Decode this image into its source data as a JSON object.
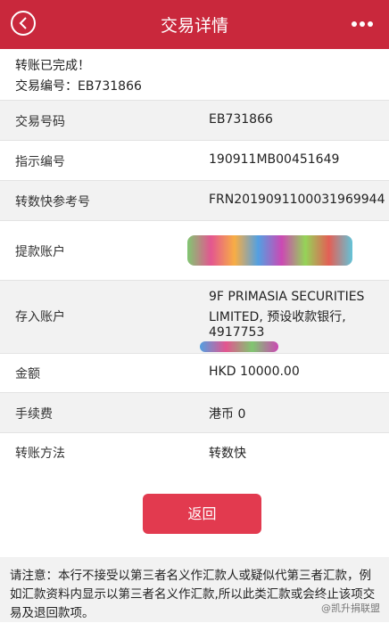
{
  "header": {
    "title": "交易详情"
  },
  "status": {
    "line1": "转账已完成！",
    "line2": "交易编号：EB731866"
  },
  "rows": [
    {
      "label": "交易号码",
      "value": "EB731866"
    },
    {
      "label": "指示编号",
      "value": "190911MB00451649"
    },
    {
      "label": "转数快参考号",
      "value": "FRN2019091100031969944"
    },
    {
      "label": "提款账户",
      "value": ""
    },
    {
      "label": "存入账户",
      "value_lines": [
        "9F PRIMASIA SECURITIES",
        "LIMITED, 预设收款银行,",
        "4917753"
      ]
    },
    {
      "label": "金额",
      "value": "HKD 10000.00"
    },
    {
      "label": "手续费",
      "value": "港币 0"
    },
    {
      "label": "转账方法",
      "value": "转数快"
    }
  ],
  "button": {
    "label": "返回"
  },
  "note": "请注意：本行不接受以第三者名义作汇款人或疑似代第三者汇款，例如汇款资料内显示以第三者名义作汇款,所以此类汇款或会终止该项交易及退回款项。",
  "watermark": "@凯升捐联盟",
  "colors": {
    "header": "#c9283c",
    "button": "#e23a4f"
  }
}
